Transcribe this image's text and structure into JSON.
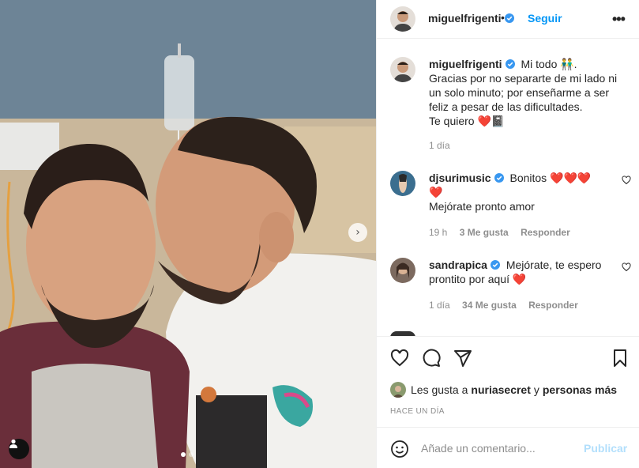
{
  "post": {
    "author": "miguelfrigenti",
    "follow_label": "Seguir",
    "separator": "•",
    "more_label": "•••",
    "caption_lines": [
      "Mi todo 👬.",
      "Gracias por no separarte de mi lado ni un solo minuto; por enseñarme a ser feliz a pesar de las dificultades.",
      "Te quiero ❤️📓"
    ],
    "caption_time": "1 día"
  },
  "comments": [
    {
      "user": "djsurimusic",
      "text1": "Bonitos ❤️❤️❤️",
      "text2": "❤️",
      "text3": "Mejórate pronto amor",
      "time": "19 h",
      "likes": "3 Me gusta",
      "reply": "Responder"
    },
    {
      "user": "sandrapica",
      "text1": "Mejórate, te espero prontito por aquí ❤️",
      "time": "1 día",
      "likes": "34 Me gusta",
      "reply": "Responder"
    }
  ],
  "likes": {
    "prefix": "Les gusta a",
    "user": "nuriasecret",
    "and": "y",
    "others": "personas más"
  },
  "timestamp": "HACE UN DÍA",
  "add_comment": {
    "placeholder": "Añade un comentario...",
    "publish": "Publicar"
  },
  "icons": {
    "like": "heart-icon",
    "comment": "comment-icon",
    "share": "paper-plane-icon",
    "save": "bookmark-icon",
    "emoji": "smiley-icon",
    "next": "chevron-right-icon",
    "tag": "user-tag-icon"
  },
  "colors": {
    "accent": "#0095f6",
    "verified": "#3897f0",
    "publish_disabled": "#b2dffc",
    "muted": "#8e8e8e"
  },
  "carousel": {
    "current": 1,
    "total": 2
  }
}
